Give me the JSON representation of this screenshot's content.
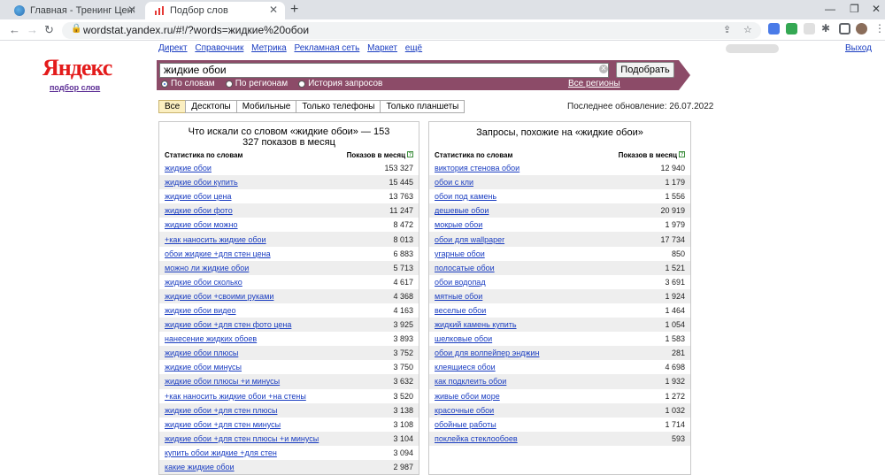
{
  "browser": {
    "tabs": [
      {
        "title": "Главная - Тренинг Центр \"Инте",
        "active": false
      },
      {
        "title": "Подбор слов",
        "active": true
      }
    ],
    "url": "wordstat.yandex.ru/#!/?words=жидкие%20обои"
  },
  "header": {
    "services": [
      "Директ",
      "Справочник",
      "Метрика",
      "Рекламная сеть",
      "Маркет",
      "ещё"
    ],
    "exit": "Выход",
    "logo": "Яндекс",
    "logo_sub": "подбор слов"
  },
  "search": {
    "query": "жидкие обои",
    "button": "Подобрать",
    "modes": [
      "По словам",
      "По регионам",
      "История запросов"
    ],
    "selected_mode": "По словам",
    "all_regions": "Все регионы"
  },
  "device_tabs": [
    "Все",
    "Десктопы",
    "Мобильные",
    "Только телефоны",
    "Только планшеты"
  ],
  "updated": "Последнее обновление: 26.07.2022",
  "left": {
    "title": "Что искали со словом «жидкие обои» — 153 327 показов в месяц",
    "col_words": "Статистика по словам",
    "col_count": "Показов в месяц",
    "rows": [
      {
        "q": "жидкие обои",
        "n": "153 327"
      },
      {
        "q": "жидкие обои купить",
        "n": "15 445"
      },
      {
        "q": "жидкие обои цена",
        "n": "13 763"
      },
      {
        "q": "жидкие обои фото",
        "n": "11 247"
      },
      {
        "q": "жидкие обои можно",
        "n": "8 472"
      },
      {
        "q": "+как наносить жидкие обои",
        "n": "8 013"
      },
      {
        "q": "обои жидкие +для стен цена",
        "n": "6 883"
      },
      {
        "q": "можно ли жидкие обои",
        "n": "5 713"
      },
      {
        "q": "жидкие обои сколько",
        "n": "4 617"
      },
      {
        "q": "жидкие обои +своими руками",
        "n": "4 368"
      },
      {
        "q": "жидкие обои видео",
        "n": "4 163"
      },
      {
        "q": "жидкие обои +для стен фото цена",
        "n": "3 925"
      },
      {
        "q": "нанесение жидких обоев",
        "n": "3 893"
      },
      {
        "q": "жидкие обои плюсы",
        "n": "3 752"
      },
      {
        "q": "жидкие обои минусы",
        "n": "3 750"
      },
      {
        "q": "жидкие обои плюсы +и минусы",
        "n": "3 632"
      },
      {
        "q": "+как наносить жидкие обои +на стены",
        "n": "3 520"
      },
      {
        "q": "жидкие обои +для стен плюсы",
        "n": "3 138"
      },
      {
        "q": "жидкие обои +для стен минусы",
        "n": "3 108"
      },
      {
        "q": "жидкие обои +для стен плюсы +и минусы",
        "n": "3 104"
      },
      {
        "q": "купить обои жидкие +для стен",
        "n": "3 094"
      },
      {
        "q": "какие жидкие обои",
        "n": "2 987"
      }
    ]
  },
  "right": {
    "title": "Запросы, похожие на «жидкие обои»",
    "col_words": "Статистика по словам",
    "col_count": "Показов в месяц",
    "rows": [
      {
        "q": "виктория стенова обои",
        "n": "12 940"
      },
      {
        "q": "обои с кли",
        "n": "1 179"
      },
      {
        "q": "обои под камень",
        "n": "1 556"
      },
      {
        "q": "дешевые обои",
        "n": "20 919"
      },
      {
        "q": "мокрые обои",
        "n": "1 979"
      },
      {
        "q": "обои для wallpaper",
        "n": "17 734"
      },
      {
        "q": "угарные обои",
        "n": "850"
      },
      {
        "q": "полосатые обои",
        "n": "1 521"
      },
      {
        "q": "обои водопад",
        "n": "3 691"
      },
      {
        "q": "мятные обои",
        "n": "1 924"
      },
      {
        "q": "веселые обои",
        "n": "1 464"
      },
      {
        "q": "жидкий камень купить",
        "n": "1 054"
      },
      {
        "q": "шелковые обои",
        "n": "1 583"
      },
      {
        "q": "обои для волпейпер энджин",
        "n": "281"
      },
      {
        "q": "клеящиеся обои",
        "n": "4 698"
      },
      {
        "q": "как подклеить обои",
        "n": "1 932"
      },
      {
        "q": "живые обои море",
        "n": "1 272"
      },
      {
        "q": "красочные обои",
        "n": "1 032"
      },
      {
        "q": "обойные работы",
        "n": "1 714"
      },
      {
        "q": "поклейка стеклообоев",
        "n": "593"
      }
    ]
  }
}
